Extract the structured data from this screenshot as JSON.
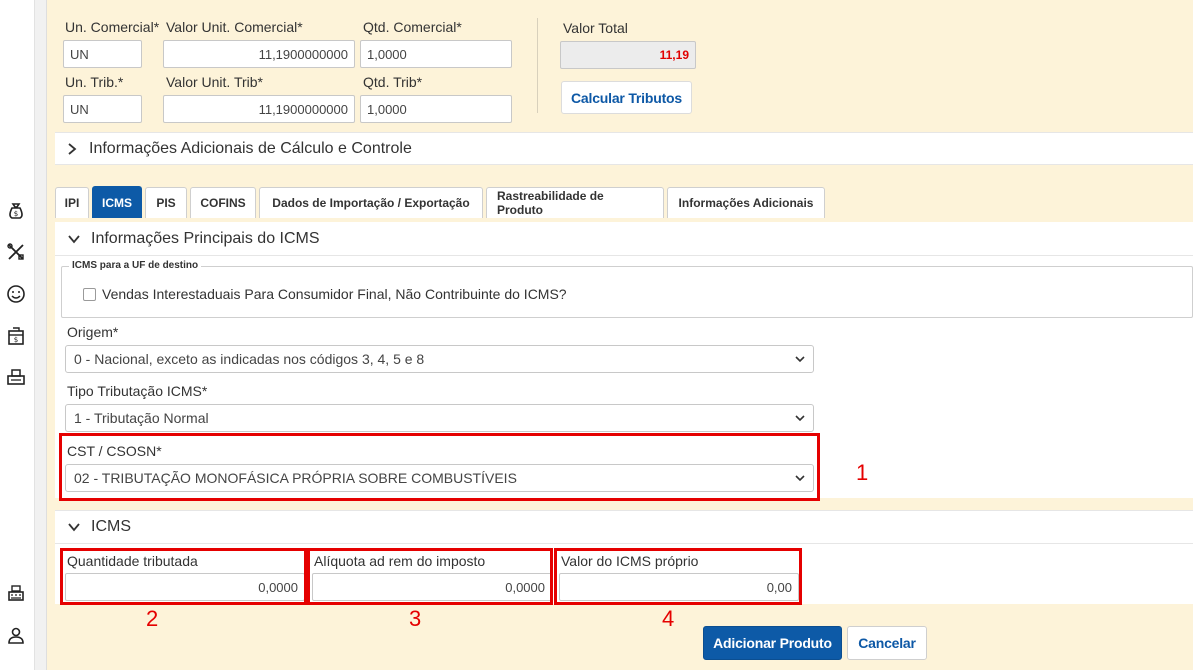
{
  "top_form": {
    "un_comercial": {
      "label": "Un. Comercial*",
      "value": "UN"
    },
    "valor_unit_comercial": {
      "label": "Valor Unit. Comercial*",
      "value": "11,1900000000"
    },
    "qtd_comercial": {
      "label": "Qtd. Comercial*",
      "value": "1,0000"
    },
    "valor_total": {
      "label": "Valor Total",
      "value": "11,19"
    },
    "un_trib": {
      "label": "Un. Trib.*",
      "value": "UN"
    },
    "valor_unit_trib": {
      "label": "Valor Unit. Trib*",
      "value": "11,1900000000"
    },
    "qtd_trib": {
      "label": "Qtd. Trib*",
      "value": "1,0000"
    },
    "calcular_button": "Calcular Tributos"
  },
  "info_adicionais_panel": "Informações Adicionais de Cálculo e Controle",
  "tabs": [
    {
      "label": "IPI",
      "active": false
    },
    {
      "label": "ICMS",
      "active": true
    },
    {
      "label": "PIS",
      "active": false
    },
    {
      "label": "COFINS",
      "active": false
    },
    {
      "label": "Dados de Importação / Exportação",
      "active": false
    },
    {
      "label": "Rastreabilidade de Produto",
      "active": false
    },
    {
      "label": "Informações Adicionais",
      "active": false
    }
  ],
  "icms_principal": {
    "header": "Informações Principais do ICMS",
    "fieldset_legend": "ICMS para a UF de destino",
    "checkbox_label": "Vendas Interestaduais Para Consumidor Final, Não Contribuinte do ICMS?",
    "checkbox_checked": false,
    "origem": {
      "label": "Origem*",
      "value": "0 - Nacional, exceto as indicadas nos códigos 3, 4, 5 e 8"
    },
    "tipo_tributacao": {
      "label": "Tipo Tributação ICMS*",
      "value": "1 - Tributação Normal"
    },
    "cst": {
      "label": "CST / CSOSN*",
      "value": "02 - TRIBUTAÇÃO MONOFÁSICA PRÓPRIA SOBRE COMBUSTÍVEIS"
    }
  },
  "icms_section": {
    "header": "ICMS",
    "quantidade": {
      "label": "Quantidade tributada",
      "value": "0,0000"
    },
    "aliquota": {
      "label": "Alíquota ad rem do imposto",
      "value": "0,0000"
    },
    "valor_icms": {
      "label": "Valor do ICMS próprio",
      "value": "0,00"
    }
  },
  "annotations": [
    "1",
    "2",
    "3",
    "4"
  ],
  "footer": {
    "add_button": "Adicionar Produto",
    "cancel_button": "Cancelar"
  },
  "sidebar_icons": [
    "money-bag-icon",
    "tools-icon",
    "smiley-icon",
    "cash-box-icon",
    "printer-icon",
    "cash-register-icon",
    "user-icon"
  ],
  "colors": {
    "primary": "#0d5aa7",
    "highlight": "#e50000",
    "background": "#fdf3d9",
    "total": "#e10000"
  }
}
